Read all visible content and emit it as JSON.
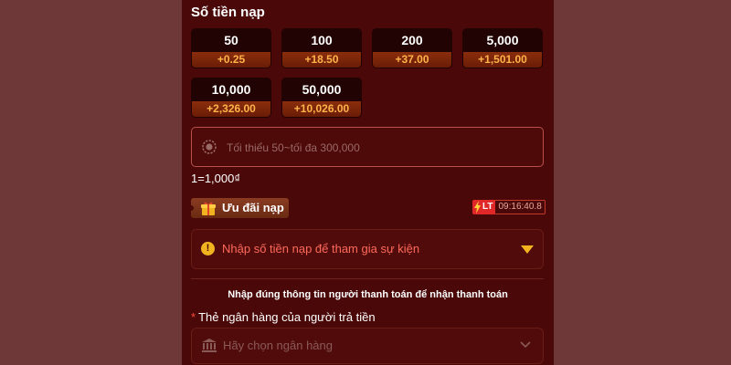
{
  "deposit": {
    "section_title": "Số tiền nạp",
    "amounts": [
      {
        "value": "50",
        "bonus": "+0.25"
      },
      {
        "value": "100",
        "bonus": "+18.50"
      },
      {
        "value": "200",
        "bonus": "+37.00"
      },
      {
        "value": "5,000",
        "bonus": "+1,501.00"
      },
      {
        "value": "10,000",
        "bonus": "+2,326.00"
      },
      {
        "value": "50,000",
        "bonus": "+10,026.00"
      }
    ],
    "input_placeholder": "Tối thiểu 50~tối đa 300,000",
    "rate": "1=1,000₫"
  },
  "promotion": {
    "tag_label": "Ưu đãi nạp",
    "badge_label": "LT",
    "timer": "09:16:40.8",
    "event_text": "Nhập số tiền nạp để tham gia sự kiện",
    "warning_symbol": "!"
  },
  "payment": {
    "notice": "Nhập đúng thông tin người thanh toán để nhận thanh toán",
    "required_mark": "*",
    "bank_label": "Thẻ ngân hàng của người trả tiền",
    "bank_placeholder": "Hãy chọn ngân hàng"
  },
  "icons": {
    "chip": "chip-icon",
    "gift": "gift-icon",
    "bolt": "lightning-icon",
    "warning": "warning-icon",
    "caret": "caret-down-icon",
    "bank": "bank-icon",
    "chevron": "chevron-down-icon"
  },
  "colors": {
    "panel_bg": "#4a0808",
    "page_bg": "#6e3838",
    "bonus_text": "#ffb24a",
    "warning_text": "#ff6a5a",
    "accent_yellow": "#f2b320"
  }
}
